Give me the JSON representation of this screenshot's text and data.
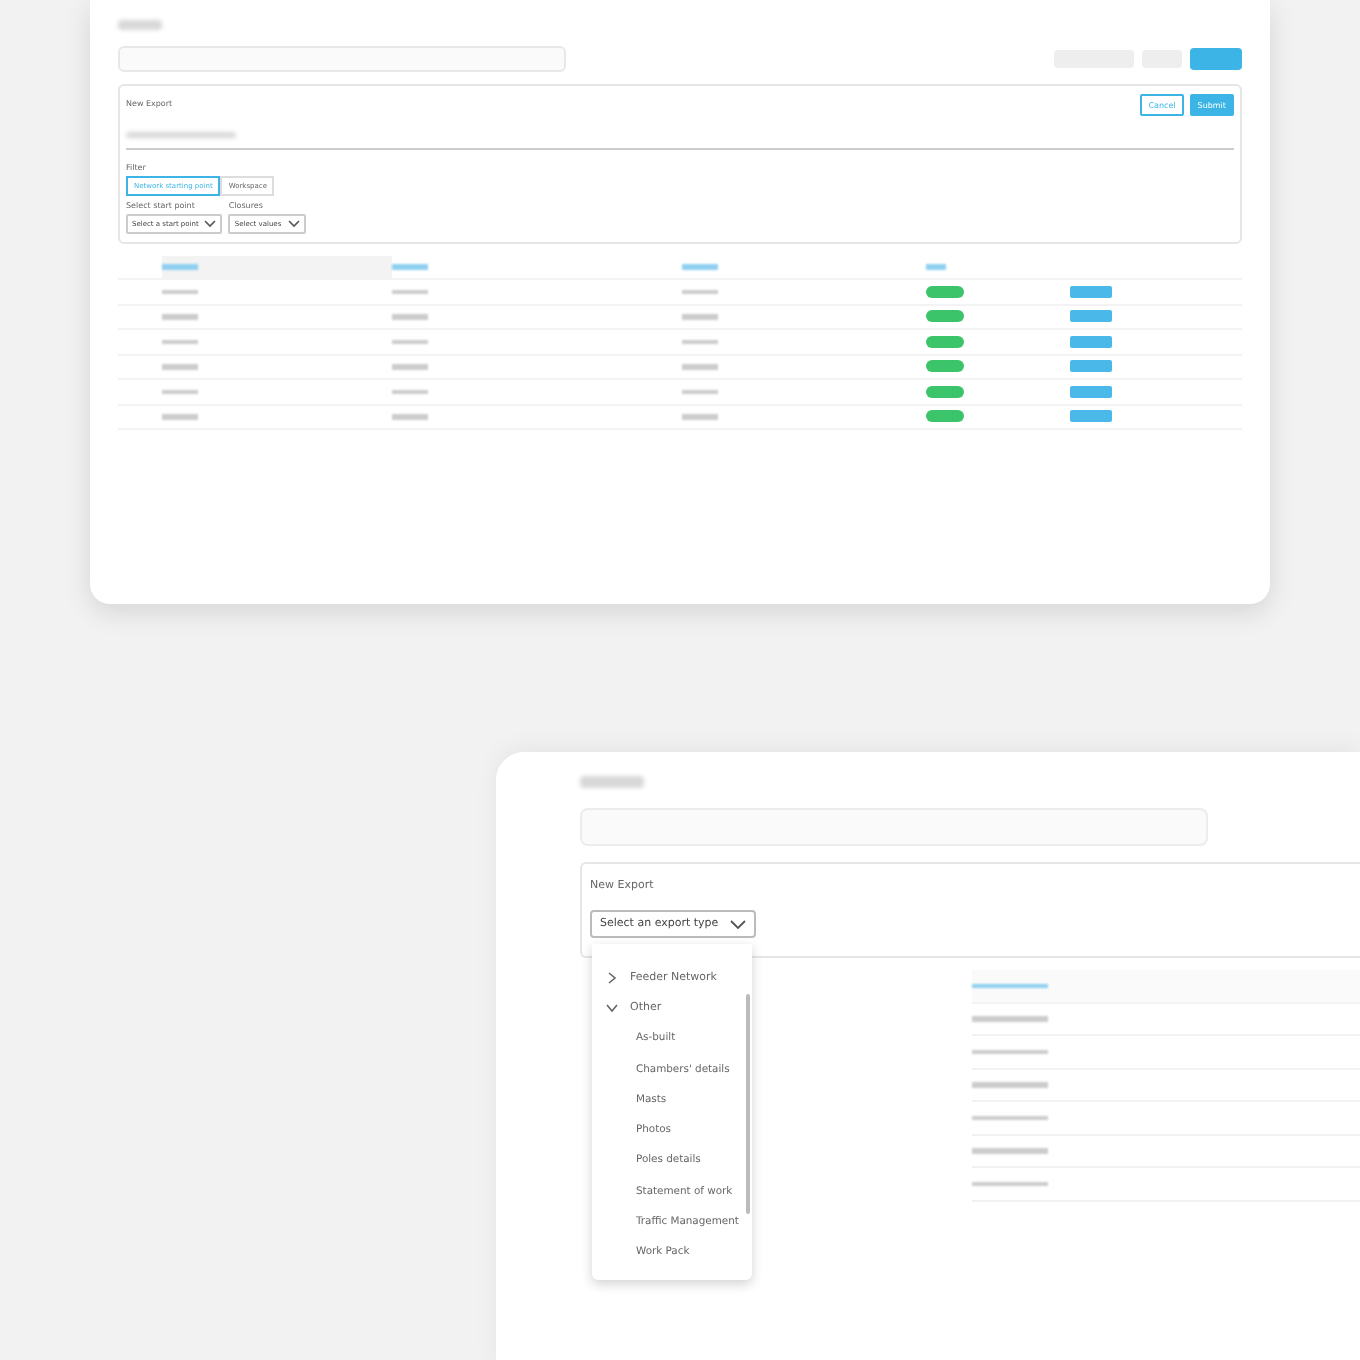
{
  "top_window": {
    "form": {
      "title": "New Export",
      "buttons": [
        {
          "label": "Cancel",
          "kind": "outline"
        },
        {
          "label": "Submit",
          "kind": "primary"
        }
      ],
      "filter_label": "Filter",
      "filter_tabs": [
        {
          "label": "Network starting point",
          "selected": true
        },
        {
          "label": "Workspace",
          "selected": false
        }
      ],
      "fields": [
        {
          "label": "Select start point",
          "placeholder": "Select a start point"
        },
        {
          "label": "Closures",
          "placeholder": "Select values"
        }
      ]
    }
  },
  "bottom_window": {
    "form": {
      "title": "New Export",
      "select": {
        "placeholder": "Select an export type"
      },
      "dropdown": [
        {
          "label": "Feeder Network",
          "expanded": false
        },
        {
          "label": "Other",
          "expanded": true,
          "children": [
            {
              "label": "As-built"
            },
            {
              "label": "Chambers' details"
            },
            {
              "label": "Masts"
            },
            {
              "label": "Photos"
            },
            {
              "label": "Poles details"
            },
            {
              "label": "Statement of work"
            },
            {
              "label": "Traffic Management"
            },
            {
              "label": "Work Pack"
            }
          ]
        }
      ]
    }
  }
}
